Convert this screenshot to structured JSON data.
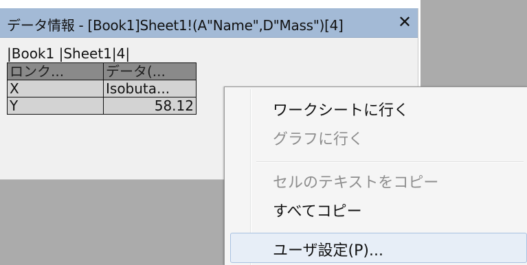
{
  "window": {
    "title": "データ情報 - [Book1]Sheet1!(A\"Name\",D\"Mass\")[4]",
    "close_label": "✕"
  },
  "path": "|Book1 |Sheet1|4|",
  "table": {
    "headers": [
      "ロンク...",
      "データ(..."
    ],
    "rows": [
      [
        "X",
        "Isobuta..."
      ],
      [
        "Y",
        "58.12"
      ]
    ]
  },
  "context_menu": {
    "items": [
      {
        "label": "ワークシートに行く",
        "enabled": true
      },
      {
        "label": "グラフに行く",
        "enabled": false
      },
      {
        "label": "セルのテキストをコピー",
        "enabled": false
      },
      {
        "label": "すべてコピー",
        "enabled": true
      },
      {
        "label": "ユーザ設定(P)...",
        "enabled": true,
        "highlighted": true
      }
    ]
  }
}
